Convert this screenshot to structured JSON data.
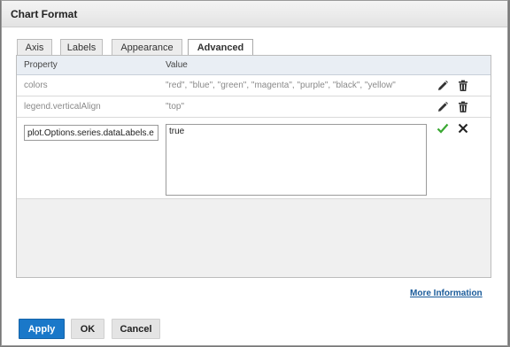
{
  "dialog": {
    "title": "Chart Format"
  },
  "tabs": [
    {
      "label": "Axis"
    },
    {
      "label": "Labels"
    },
    {
      "label": "Appearance"
    },
    {
      "label": "Advanced"
    }
  ],
  "grid": {
    "headers": {
      "property": "Property",
      "value": "Value"
    },
    "rows": [
      {
        "property": "colors",
        "value": "\"red\", \"blue\", \"green\", \"magenta\", \"purple\", \"black\", \"yellow\""
      },
      {
        "property": "legend.verticalAlign",
        "value": "\"top\""
      }
    ],
    "edit_row": {
      "property": "plot.Options.series.dataLabels.e",
      "value": "true"
    }
  },
  "links": {
    "more_information": "More Information"
  },
  "buttons": {
    "apply": "Apply",
    "ok": "OK",
    "cancel": "Cancel"
  },
  "icons": {
    "edit": "pencil-icon",
    "delete": "trash-icon",
    "confirm": "checkmark-icon",
    "cancel": "close-icon"
  },
  "colors": {
    "accent": "#1a78c9",
    "confirm": "#3aa832",
    "link": "#1a5b9a"
  }
}
